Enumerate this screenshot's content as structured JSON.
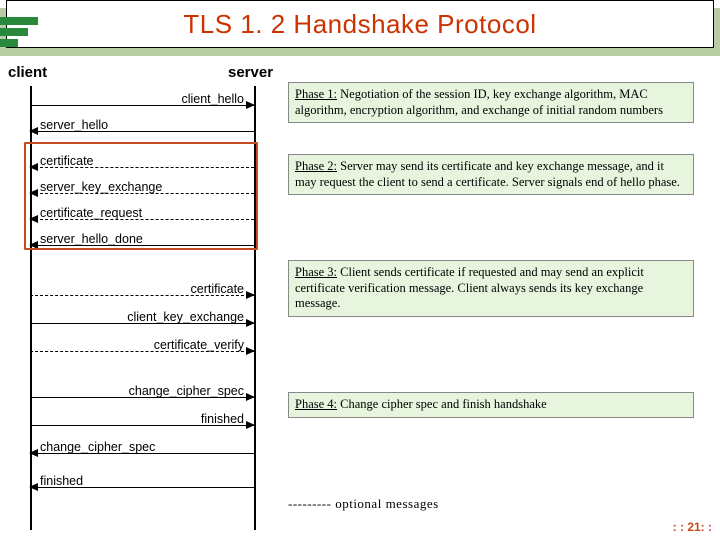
{
  "title": "TLS 1. 2 Handshake Protocol",
  "roles": {
    "client": "client",
    "server": "server"
  },
  "messages": {
    "m0": "client_hello",
    "m1": "server_hello",
    "m2": "certificate",
    "m3": "server_key_exchange",
    "m4": "certificate_request",
    "m5": "server_hello_done",
    "m6": "certificate",
    "m7": "client_key_exchange",
    "m8": "certificate_verify",
    "m9": "change_cipher_spec",
    "m10": "finished",
    "m11": "change_cipher_spec",
    "m12": "finished"
  },
  "phases": {
    "p1": {
      "title": "Phase 1:",
      "text": " Negotiation of the session ID, key exchange algorithm, MAC algorithm, encryption algorithm, and  exchange of initial random numbers"
    },
    "p2": {
      "title": "Phase 2:",
      "text": " Server may send its certificate and key exchange message, and it may request the client to send a certificate. Server signals end of hello phase."
    },
    "p3": {
      "title": "Phase 3:",
      "text": " Client sends certificate if requested and may send an explicit certificate verification message. Client always sends its key exchange message."
    },
    "p4": {
      "title": "Phase 4:",
      "text": " Change cipher spec and finish handshake"
    }
  },
  "legend": "---------  optional messages",
  "page": ": : 21: :"
}
